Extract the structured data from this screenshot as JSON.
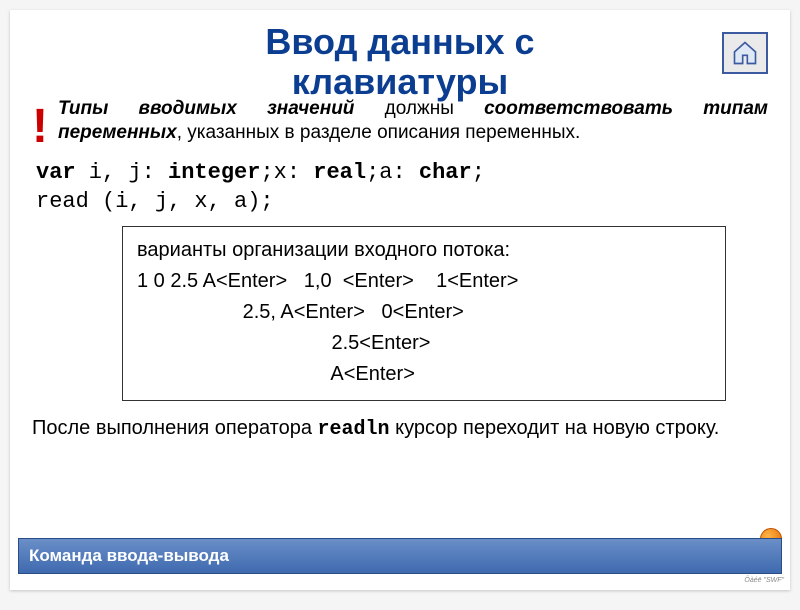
{
  "title_line1": "Ввод данных с",
  "title_line2": "клавиатуры",
  "warning": {
    "mark": "!",
    "italic_bold_1": "Типы вводимых значений",
    "plain_1": " должны ",
    "italic_bold_2": "соответствовать типам переменных",
    "plain_2": ", указанных в разделе описания переменных."
  },
  "code_block": {
    "kw_var": "var",
    "part1": " i, j: ",
    "kw_int": "integer",
    "part2": ";x: ",
    "kw_real": "real",
    "part3": ";a: ",
    "kw_char": "char",
    "part4": ";",
    "line2": "read (i, j, x, a);"
  },
  "box": {
    "heading": "варианты организации входного потока:",
    "r1": "1 0 2.5 A<Enter>   1,0  <Enter>    1<Enter>",
    "r2": "                   2.5, A<Enter>   0<Enter>",
    "r3": "                                   2.5<Enter>",
    "r4": "                                   A<Enter>"
  },
  "after": {
    "t1": "После выполнения оператора ",
    "mono": "readln",
    "t2": " курсор переходит на новую строку."
  },
  "footer": "Команда ввода-вывода",
  "tiny": "Ôàéë \"SWF\""
}
